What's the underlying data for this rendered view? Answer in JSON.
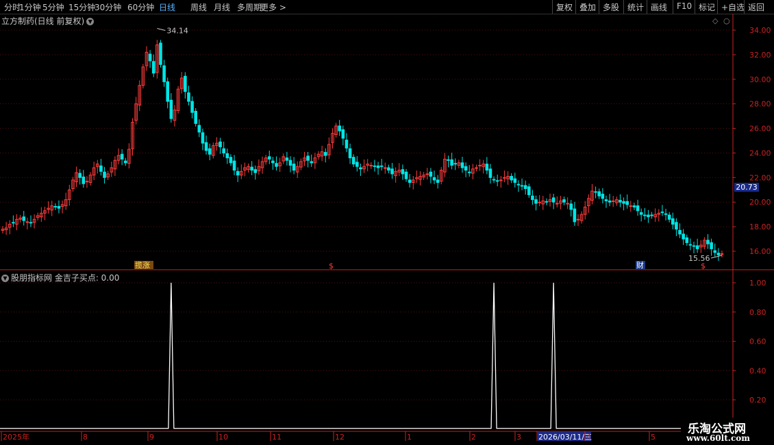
{
  "toolbar": {
    "periods": [
      "分时",
      "1分钟",
      "5分钟",
      "15分钟",
      "30分钟",
      "60分钟",
      "日线",
      "周线",
      "月线",
      "多周期",
      "更多 >"
    ],
    "active_index": 6,
    "right": [
      "复权",
      "叠加",
      "多股",
      "统计",
      "画线",
      "F10",
      "标记",
      "+自选",
      "返回"
    ]
  },
  "main_title": "立方制药(日线 前复权)",
  "indicator_title": "股朋指标网  金吉子买点: 0.00",
  "current_price_tag": "20.73",
  "markers": {
    "left": "揽涨",
    "mid": "$",
    "right": "财",
    "right2": "$"
  },
  "watermark": {
    "line1": "乐淘公式网",
    "line2": "www.60lt.com"
  },
  "date_axis": {
    "labels": [
      "2025年",
      "8",
      "9",
      "10",
      "11",
      "12",
      "1",
      "2",
      "3",
      "2026/03/11/三",
      "4",
      "5"
    ]
  },
  "colors": {
    "up": "#ff3c3c",
    "down": "#00e5e5",
    "axis": "#cc2222",
    "line": "#ffffff"
  },
  "chart_data": [
    {
      "type": "candlestick",
      "title": "立方制药(日线 前复权)",
      "ylim": [
        15,
        35
      ],
      "yticks": [
        "34.00",
        "32.00",
        "30.00",
        "28.00",
        "26.00",
        "24.00",
        "22.00",
        "20.00",
        "18.00",
        "16.00"
      ],
      "annotations": {
        "high": "34.14",
        "low": "15.56"
      },
      "closes": [
        17.8,
        17.9,
        18.2,
        18.3,
        18.6,
        18.7,
        18.5,
        18.4,
        18.3,
        18.6,
        18.9,
        19.1,
        19.3,
        19.5,
        19.7,
        19.6,
        19.5,
        19.8,
        20.2,
        21.0,
        21.8,
        22.4,
        22.0,
        21.5,
        21.7,
        22.2,
        22.8,
        23.1,
        22.5,
        22.0,
        22.3,
        22.8,
        23.4,
        23.8,
        23.5,
        23.2,
        24.3,
        26.5,
        28.0,
        29.5,
        31.0,
        32.2,
        31.5,
        30.5,
        32.8,
        31.2,
        29.8,
        28.2,
        26.8,
        27.5,
        29.2,
        30.1,
        29.0,
        28.2,
        27.3,
        26.4,
        25.7,
        24.8,
        24.2,
        23.9,
        24.6,
        24.8,
        24.5,
        24.0,
        23.6,
        23.2,
        22.6,
        22.2,
        22.5,
        22.8,
        22.9,
        22.6,
        22.4,
        22.9,
        23.3,
        23.6,
        23.5,
        23.2,
        22.9,
        23.2,
        23.7,
        23.4,
        23.0,
        22.6,
        22.9,
        23.3,
        23.6,
        23.4,
        23.2,
        23.6,
        23.9,
        24.1,
        23.8,
        24.7,
        25.6,
        26.2,
        25.8,
        25.2,
        24.4,
        23.6,
        23.1,
        22.9,
        22.7,
        22.9,
        23.1,
        23.0,
        22.9,
        22.8,
        22.9,
        22.8,
        22.6,
        22.3,
        22.5,
        22.6,
        22.3,
        21.9,
        21.6,
        21.8,
        22.0,
        22.1,
        22.2,
        22.3,
        22.1,
        21.8,
        21.6,
        22.6,
        23.5,
        23.4,
        23.0,
        23.1,
        23.2,
        22.8,
        22.6,
        22.4,
        22.7,
        22.8,
        23.0,
        23.1,
        22.6,
        22.0,
        21.8,
        21.7,
        21.8,
        22.0,
        22.1,
        21.8,
        21.6,
        21.4,
        21.3,
        21.1,
        20.6,
        20.2,
        19.9,
        20.0,
        20.1,
        20.0,
        20.2,
        20.0,
        19.9,
        20.1,
        20.0,
        19.9,
        19.4,
        18.4,
        18.6,
        19.0,
        19.6,
        20.3,
        20.9,
        20.8,
        20.5,
        20.3,
        20.1,
        20.0,
        20.1,
        20.2,
        20.0,
        19.9,
        19.8,
        19.7,
        19.6,
        19.3,
        19.0,
        18.9,
        18.8,
        18.9,
        19.0,
        19.1,
        19.2,
        19.0,
        18.6,
        18.2,
        17.8,
        17.4,
        17.0,
        16.7,
        16.5,
        16.4,
        16.2,
        16.5,
        16.9,
        16.6,
        16.2,
        15.9,
        15.7,
        15.8
      ]
    },
    {
      "type": "line",
      "title": "金吉子买点",
      "ylim": [
        0,
        1.1
      ],
      "yticks": [
        "1.00",
        "0.80",
        "0.60",
        "0.40",
        "0.20"
      ],
      "spike_positions": [
        48,
        140,
        157
      ],
      "values_info": "binary 0/1 signal"
    }
  ]
}
